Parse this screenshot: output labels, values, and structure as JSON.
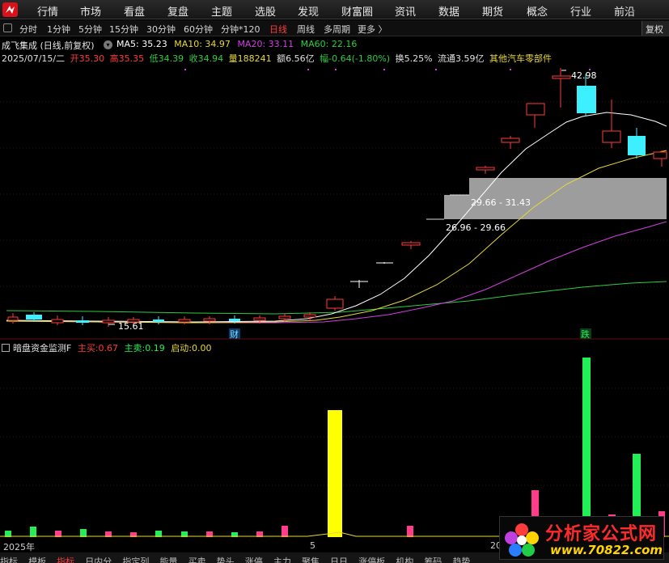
{
  "menu": {
    "items": [
      "行情",
      "市场",
      "看盘",
      "复盘",
      "主题",
      "选股",
      "发现",
      "财富圈",
      "资讯",
      "数据",
      "期货",
      "概念",
      "行业",
      "前沿"
    ]
  },
  "toolbar": {
    "periods": [
      "分时",
      "1分钟",
      "5分钟",
      "15分钟",
      "30分钟",
      "60分钟",
      "分钟*120",
      "日线",
      "周线",
      "多周期",
      "更多 〉"
    ],
    "active": "日线",
    "fuquan_label": "复权"
  },
  "stock": {
    "name": "成飞集成 (日线,前复权)"
  },
  "ma": {
    "ma5": "MA5: 35.23",
    "ma10": "MA10: 34.97",
    "ma20": "MA20: 33.11",
    "ma60": "MA60: 22.16"
  },
  "quote": {
    "date": "2025/07/15/二",
    "open": "开35.30",
    "high": "高35.35",
    "low": "低34.39",
    "close": "收34.94",
    "volume": "量188241",
    "amount": "额6.56亿",
    "change": "幅-0.64(-1.80%)",
    "turnover": "换5.25%",
    "float": "流通3.59亿",
    "sector": "其他汽车零部件"
  },
  "chart_annotations": {
    "high_label": "42.98",
    "low_label": "15.61",
    "zone1_label": "29.66 - 31.43",
    "zone2_label": "26.96 - 29.66",
    "marker_cai": "财",
    "marker_die": "跌"
  },
  "indicator": {
    "name": "暗盘资金监测F",
    "zhumai_label": "主买:",
    "zhumai_value": "0.67",
    "zhumai2_label": "主卖:",
    "zhumai2_value": "0.19",
    "qidong_label": "启动:",
    "qidong_value": "0.00"
  },
  "axis": {
    "date_left": "2025年",
    "date_mid": "5",
    "date_right": "20"
  },
  "bottom_tabs": [
    "指标",
    "模板",
    "指标",
    "日内分",
    "指定列",
    "能量",
    "买卖",
    "势头",
    "涨停",
    "主力",
    "聚焦",
    "日日",
    "涨停板",
    "机构",
    "筹码",
    "趋势"
  ],
  "watermark": {
    "line1": "分析家公式网",
    "line2": "www.70822.com"
  },
  "colors": {
    "up": "#ff3b3b",
    "down": "#3cf0ff",
    "ma5": "#ffffff",
    "ma10": "#e8d83a",
    "ma20": "#d040e0",
    "ma60": "#2ecc40",
    "zone": "#b8b8b8",
    "vol_yellow": "#ffff00",
    "vol_green": "#22ee55",
    "vol_pink": "#ff3d8a"
  }
}
